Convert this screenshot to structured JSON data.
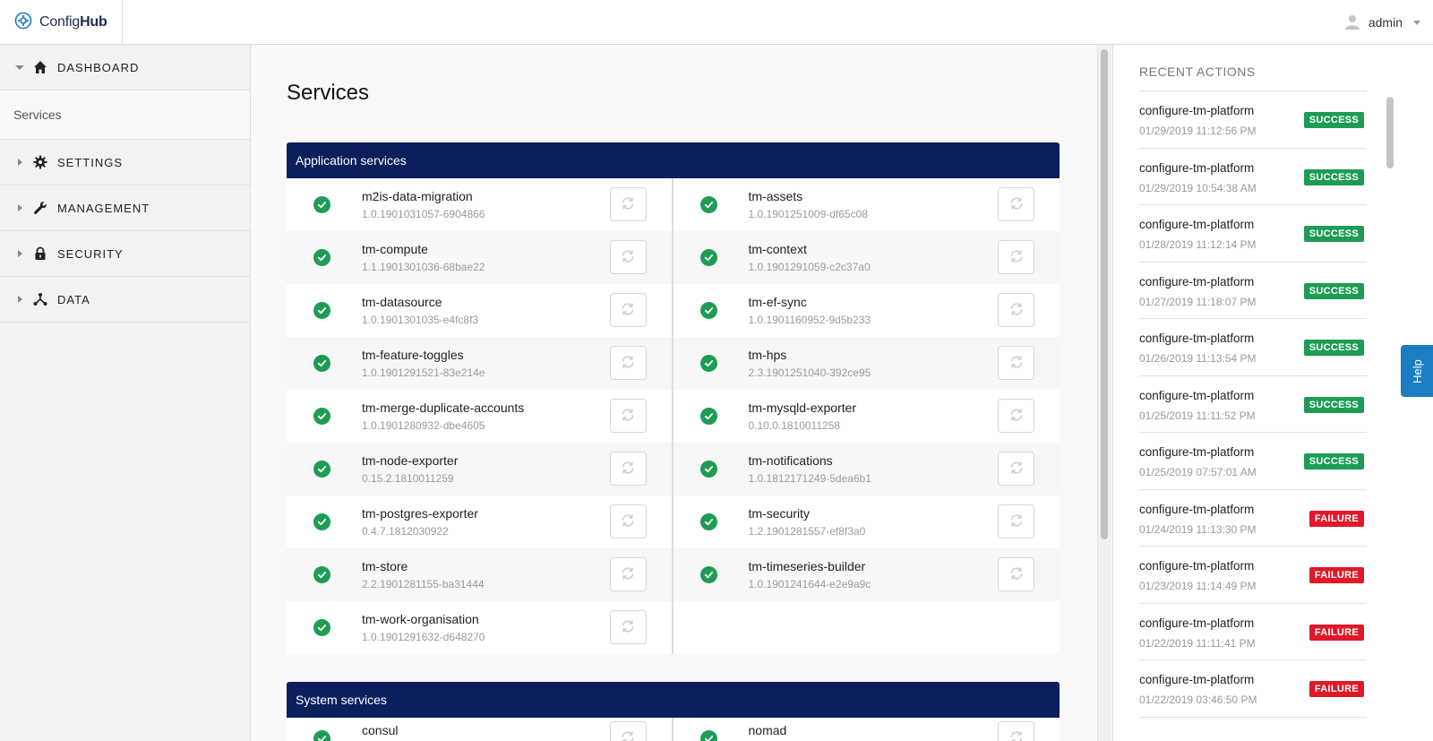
{
  "brand": {
    "name_part1": "Config",
    "name_part2": "Hub"
  },
  "user": {
    "name": "admin"
  },
  "sidebar": {
    "dashboard": "DASHBOARD",
    "services": "Services",
    "settings": "SETTINGS",
    "management": "MANAGEMENT",
    "security": "SECURITY",
    "data": "DATA"
  },
  "main": {
    "title": "Services",
    "app_panel_title": "Application services",
    "sys_panel_title": "System services",
    "app_left": [
      {
        "name": "m2is-data-migration",
        "version": "1.0.1901031057-6904866"
      },
      {
        "name": "tm-compute",
        "version": "1.1.1901301036-68bae22"
      },
      {
        "name": "tm-datasource",
        "version": "1.0.1901301035-e4fc8f3"
      },
      {
        "name": "tm-feature-toggles",
        "version": "1.0.1901291521-83e214e"
      },
      {
        "name": "tm-merge-duplicate-accounts",
        "version": "1.0.1901280932-dbe4605"
      },
      {
        "name": "tm-node-exporter",
        "version": "0.15.2.1810011259"
      },
      {
        "name": "tm-postgres-exporter",
        "version": "0.4.7.1812030922"
      },
      {
        "name": "tm-store",
        "version": "2.2.1901281155-ba31444"
      },
      {
        "name": "tm-work-organisation",
        "version": "1.0.1901291632-d648270"
      }
    ],
    "app_right": [
      {
        "name": "tm-assets",
        "version": "1.0.1901251009-df65c08"
      },
      {
        "name": "tm-context",
        "version": "1.0.1901291059-c2c37a0"
      },
      {
        "name": "tm-ef-sync",
        "version": "1.0.1901160952-9d5b233"
      },
      {
        "name": "tm-hps",
        "version": "2.3.1901251040-392ce95"
      },
      {
        "name": "tm-mysqld-exporter",
        "version": "0.10.0.1810011258"
      },
      {
        "name": "tm-notifications",
        "version": "1.0.1812171249-5dea6b1"
      },
      {
        "name": "tm-security",
        "version": "1.2.1901281557-ef8f3a0"
      },
      {
        "name": "tm-timeseries-builder",
        "version": "1.0.1901241644-e2e9a9c"
      }
    ],
    "sys_left": [
      {
        "name": "consul"
      }
    ],
    "sys_right": [
      {
        "name": "nomad"
      }
    ]
  },
  "recent": {
    "title": "RECENT ACTIONS",
    "actions": [
      {
        "name": "configure-tm-platform",
        "time": "01/29/2019 11:12:56 PM",
        "status": "SUCCESS"
      },
      {
        "name": "configure-tm-platform",
        "time": "01/29/2019 10:54:38 AM",
        "status": "SUCCESS"
      },
      {
        "name": "configure-tm-platform",
        "time": "01/28/2019 11:12:14 PM",
        "status": "SUCCESS"
      },
      {
        "name": "configure-tm-platform",
        "time": "01/27/2019 11:18:07 PM",
        "status": "SUCCESS"
      },
      {
        "name": "configure-tm-platform",
        "time": "01/26/2019 11:13:54 PM",
        "status": "SUCCESS"
      },
      {
        "name": "configure-tm-platform",
        "time": "01/25/2019 11:11:52 PM",
        "status": "SUCCESS"
      },
      {
        "name": "configure-tm-platform",
        "time": "01/25/2019 07:57:01 AM",
        "status": "SUCCESS"
      },
      {
        "name": "configure-tm-platform",
        "time": "01/24/2019 11:13:30 PM",
        "status": "FAILURE"
      },
      {
        "name": "configure-tm-platform",
        "time": "01/23/2019 11:14:49 PM",
        "status": "FAILURE"
      },
      {
        "name": "configure-tm-platform",
        "time": "01/22/2019 11:11:41 PM",
        "status": "FAILURE"
      },
      {
        "name": "configure-tm-platform",
        "time": "01/22/2019 03:46:50 PM",
        "status": "FAILURE"
      }
    ]
  },
  "help": {
    "label": "Help"
  },
  "colors": {
    "header_navy": "#0b1f5c",
    "success": "#1e9c55",
    "failure": "#e0192a",
    "help_blue": "#1b7ec2"
  },
  "icons": {
    "brand": "gear-icon",
    "user": "user-icon",
    "dashboard": "home-icon",
    "settings": "gear-icon",
    "management": "wrench-icon",
    "security": "lock-icon",
    "data": "share-nodes-icon",
    "status": "check-circle-icon",
    "refresh": "refresh-icon"
  }
}
